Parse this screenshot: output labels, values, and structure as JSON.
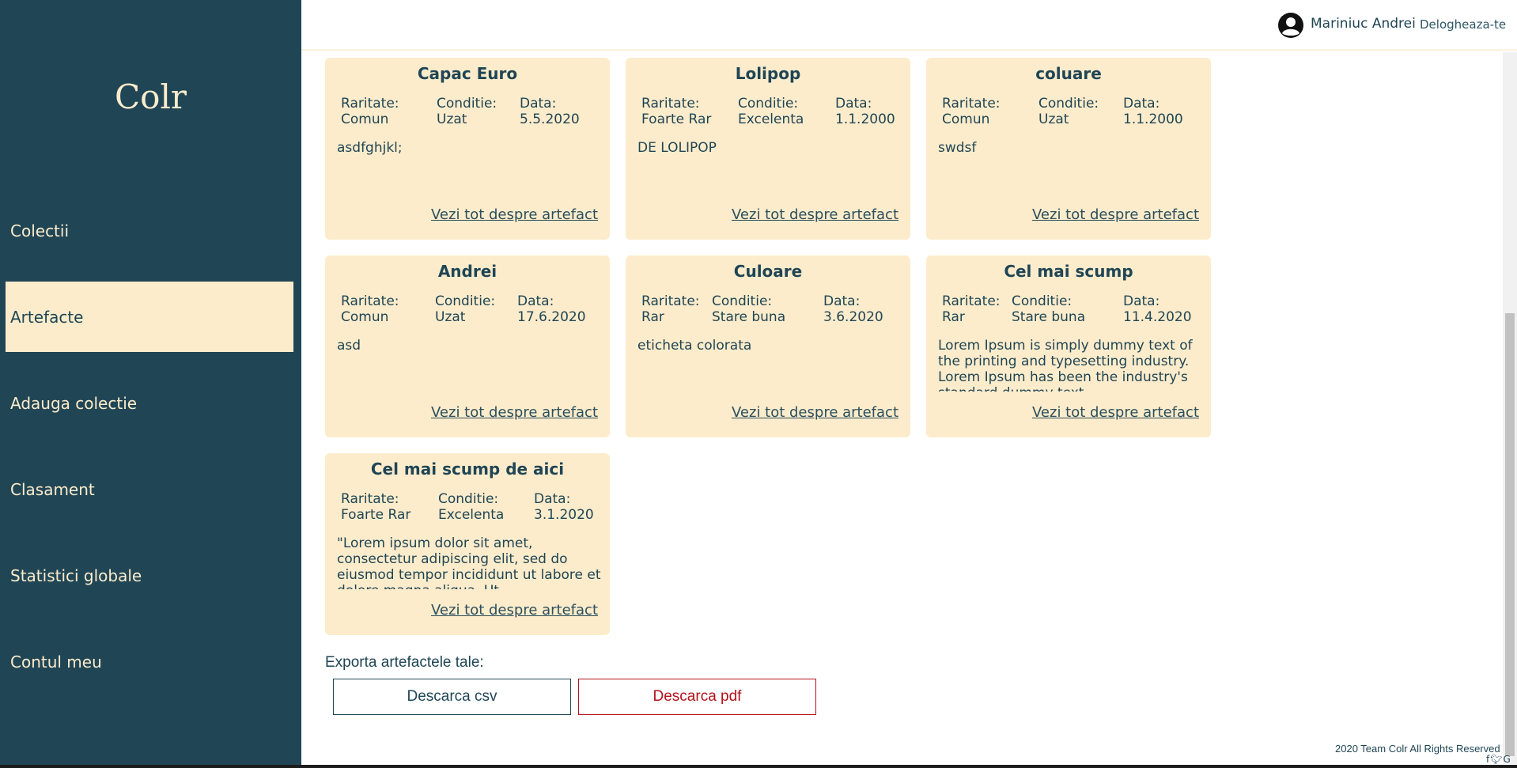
{
  "app": {
    "logo": "Colr"
  },
  "sidebar": {
    "items": [
      {
        "label": "Colectii",
        "active": false
      },
      {
        "label": "Artefacte",
        "active": true
      },
      {
        "label": "Adauga colectie",
        "active": false
      },
      {
        "label": "Clasament",
        "active": false
      },
      {
        "label": "Statistici globale",
        "active": false
      },
      {
        "label": "Contul meu",
        "active": false
      }
    ]
  },
  "header": {
    "user_name": "Mariniuc Andrei",
    "logout_label": "Delogheaza-te"
  },
  "field_labels": {
    "rarity": "Raritate:",
    "condition": "Conditie:",
    "date": "Data:"
  },
  "artifacts": [
    {
      "title": "Capac Euro",
      "rarity": "Comun",
      "condition": "Uzat",
      "date": "5.5.2020",
      "description": "asdfghjkl;",
      "link": "Vezi tot despre artefact"
    },
    {
      "title": "Lolipop",
      "rarity": "Foarte Rar",
      "condition": "Excelenta",
      "date": "1.1.2000",
      "description": "DE LOLIPOP",
      "link": "Vezi tot despre artefact"
    },
    {
      "title": "coluare",
      "rarity": "Comun",
      "condition": "Uzat",
      "date": "1.1.2000",
      "description": "swdsf",
      "link": "Vezi tot despre artefact"
    },
    {
      "title": "Andrei",
      "rarity": "Comun",
      "condition": "Uzat",
      "date": "17.6.2020",
      "description": "asd",
      "link": "Vezi tot despre artefact"
    },
    {
      "title": "Culoare",
      "rarity": "Rar",
      "condition": "Stare buna",
      "date": "3.6.2020",
      "description": "eticheta colorata",
      "link": "Vezi tot despre artefact"
    },
    {
      "title": "Cel mai scump",
      "rarity": "Rar",
      "condition": "Stare buna",
      "date": "11.4.2020",
      "description": "Lorem Ipsum is simply dummy text of the printing and typesetting industry. Lorem Ipsum has been the industry's standard dummy text",
      "link": "Vezi tot despre artefact"
    },
    {
      "title": "Cel mai scump de aici",
      "rarity": "Foarte Rar",
      "condition": "Excelenta",
      "date": "3.1.2020",
      "description": "\"Lorem ipsum dolor sit amet, consectetur adipiscing elit, sed do eiusmod tempor incididunt ut labore et dolore magna aliqua. Ut",
      "link": "Vezi tot despre artefact"
    }
  ],
  "export": {
    "label": "Exporta artefactele tale:",
    "csv_button": "Descarca csv",
    "pdf_button": "Descarca pdf"
  },
  "footer": {
    "text": "2020 Team Colr All Rights Reserved",
    "social_icons": [
      "facebook-icon",
      "twitter-icon",
      "google-icon"
    ]
  },
  "colors": {
    "sidebar_bg": "#204656",
    "card_bg": "#fdeccb",
    "accent_text": "#1f4555",
    "pdf_red": "#b3121c"
  }
}
